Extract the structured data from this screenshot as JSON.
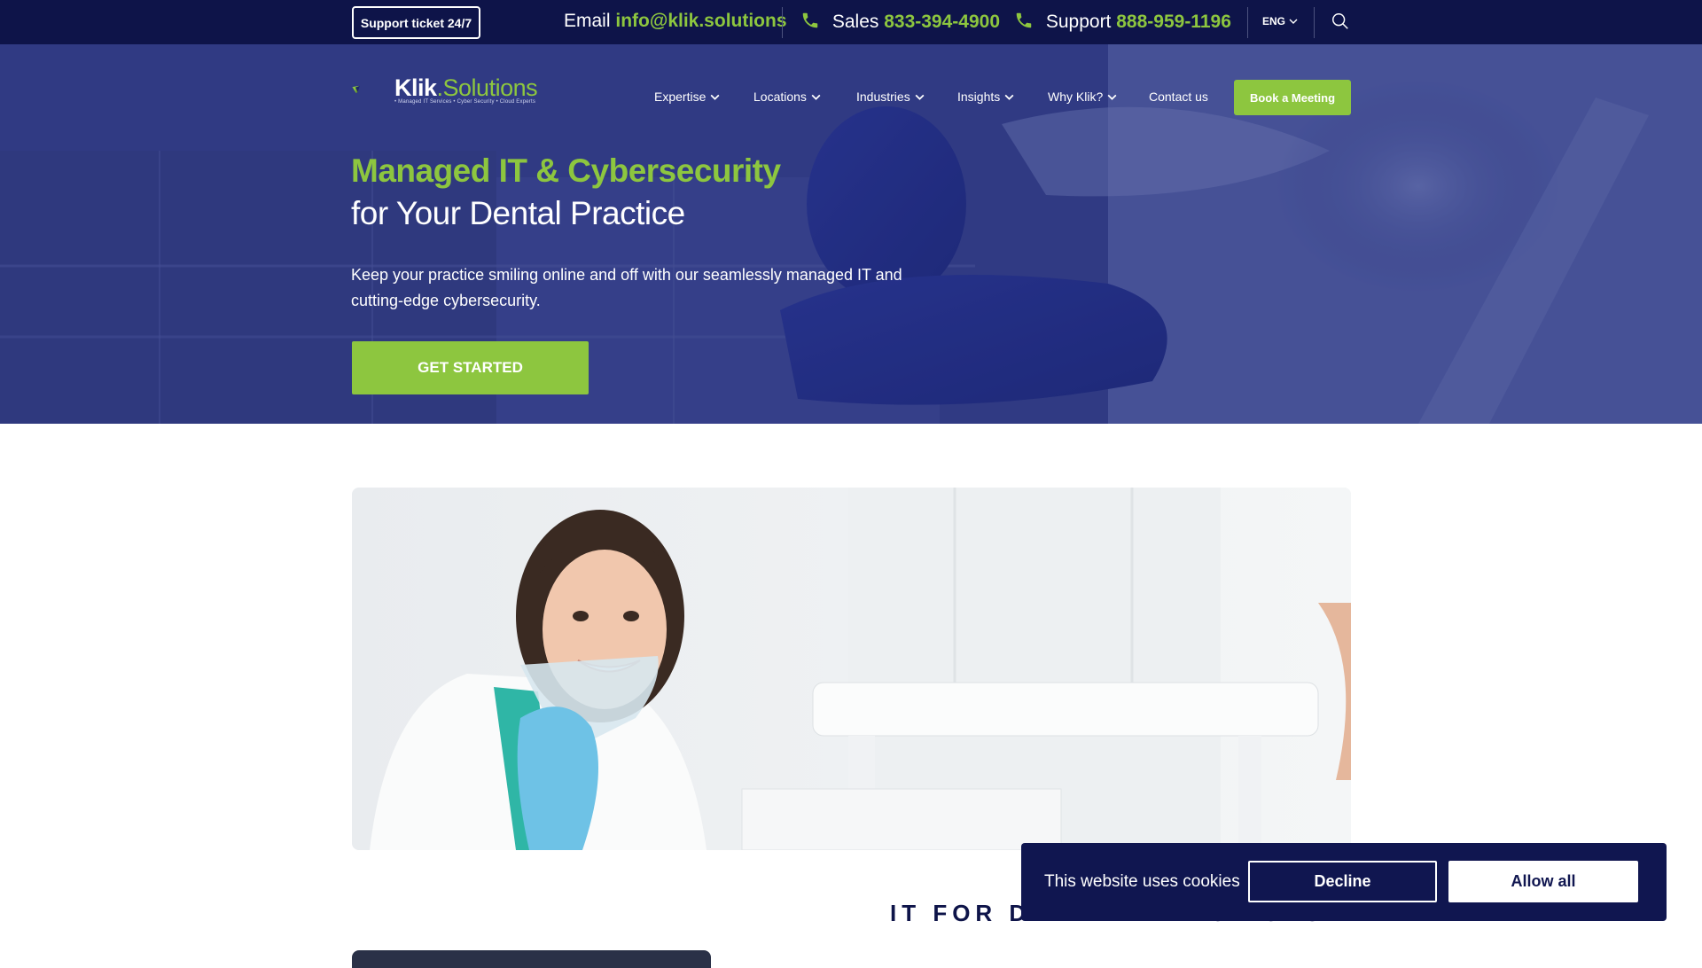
{
  "topbar": {
    "support_ticket_label": "Support ticket 24/7",
    "email_label": "Email",
    "email_value": "info@klik.solutions",
    "sales_label": "Sales",
    "sales_phone": "833-394-4900",
    "support_label": "Support",
    "support_phone": "888-959-1196",
    "language": "ENG",
    "icons": {
      "phone": "phone-icon",
      "search": "search-icon",
      "chevron": "chevron-down-icon"
    }
  },
  "header": {
    "logo_brand": "Klik",
    "logo_suffix": ".Solutions",
    "logo_tagline": "• Managed IT Services • Cyber Security • Cloud Experts",
    "nav": [
      {
        "label": "Expertise",
        "has_dropdown": true
      },
      {
        "label": "Locations",
        "has_dropdown": true
      },
      {
        "label": "Industries",
        "has_dropdown": true
      },
      {
        "label": "Insights",
        "has_dropdown": true
      },
      {
        "label": "Why Klik?",
        "has_dropdown": true
      },
      {
        "label": "Contact us",
        "has_dropdown": false
      }
    ],
    "cta_label": "Book a Meeting"
  },
  "hero": {
    "title_line1": "Managed IT & Cybersecurity",
    "title_line2": "for Your Dental Practice",
    "description": "Keep your practice smiling online and off with our seamlessly managed IT and cutting-edge cybersecurity.",
    "button_label": "GET STARTED"
  },
  "section": {
    "title": "IT FOR DENTAL PRACTICES"
  },
  "cookie_banner": {
    "message": "This website uses cookies",
    "decline_label": "Decline",
    "allow_label": "Allow all"
  },
  "colors": {
    "navy": "#0e1449",
    "accent_green": "#8dc63f",
    "white": "#ffffff"
  }
}
